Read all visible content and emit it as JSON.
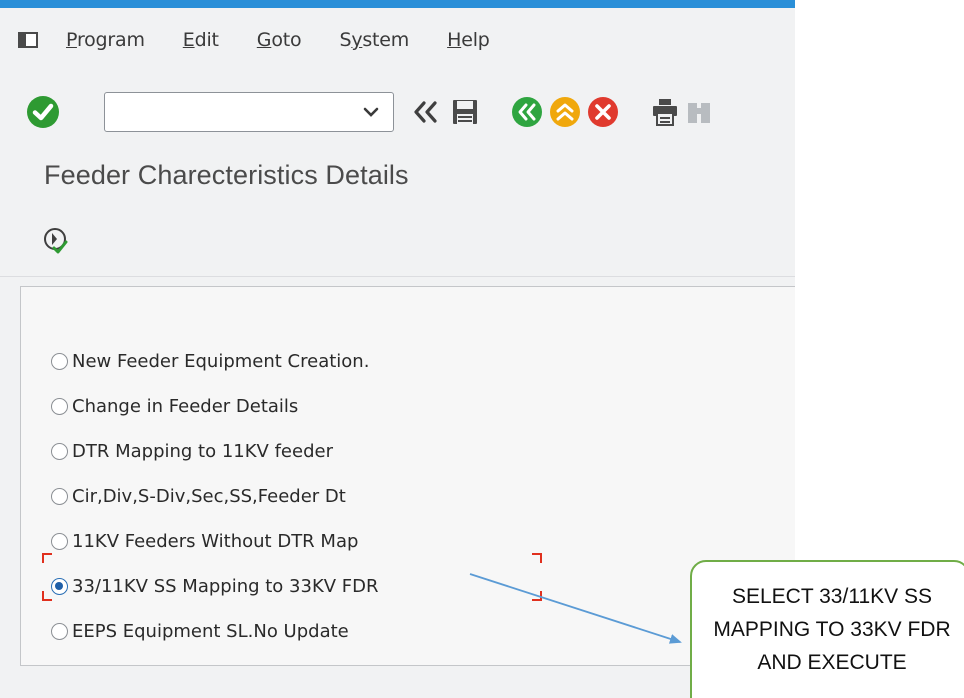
{
  "menu": {
    "items": [
      {
        "key": "P",
        "rest": "rogram"
      },
      {
        "key": "E",
        "rest": "dit"
      },
      {
        "key": "G",
        "rest": "oto"
      },
      {
        "key": "",
        "prefix": "S",
        "mid": "y",
        "rest": "stem"
      },
      {
        "key": "H",
        "rest": "elp"
      }
    ],
    "program": {
      "u": "P",
      "rest": "rogram"
    },
    "edit": {
      "u": "E",
      "rest": "dit"
    },
    "goto": {
      "u": "G",
      "rest": "oto"
    },
    "system": {
      "pre": "S",
      "u": "y",
      "rest": "stem"
    },
    "help": {
      "u": "H",
      "rest": "elp"
    }
  },
  "toolbar": {
    "command_field_value": "",
    "icons": [
      "enter-check-icon",
      "dropdown-chevron-icon",
      "double-chevron-left-icon",
      "save-icon",
      "back-icon",
      "exit-icon",
      "cancel-icon",
      "print-icon",
      "find-icon"
    ]
  },
  "page": {
    "title": "Feeder Charecteristics Details"
  },
  "options": [
    {
      "label": "New Feeder Equipment Creation.",
      "selected": false
    },
    {
      "label": "Change in Feeder Details",
      "selected": false
    },
    {
      "label": "DTR Mapping to 11KV feeder",
      "selected": false
    },
    {
      "label": "Cir,Div,S-Div,Sec,SS,Feeder Dt",
      "selected": false
    },
    {
      "label": "11KV Feeders Without DTR Map",
      "selected": false
    },
    {
      "label": "33/11KV SS Mapping to 33KV FDR",
      "selected": true
    },
    {
      "label": "EEPS Equipment SL.No Update",
      "selected": false
    }
  ],
  "callout": {
    "text": "SELECT 33/11KV SS MAPPING TO 33KV FDR AND EXECUTE"
  },
  "colors": {
    "top_stripe": "#2a8fd8",
    "check_green": "#2e9a32",
    "back_green": "#2fa540",
    "exit_yellow": "#f0a80c",
    "cancel_red": "#e03a2e",
    "callout_border": "#70ad47",
    "focus_red": "#e0301e",
    "arrow_blue": "#5b9bd5"
  }
}
